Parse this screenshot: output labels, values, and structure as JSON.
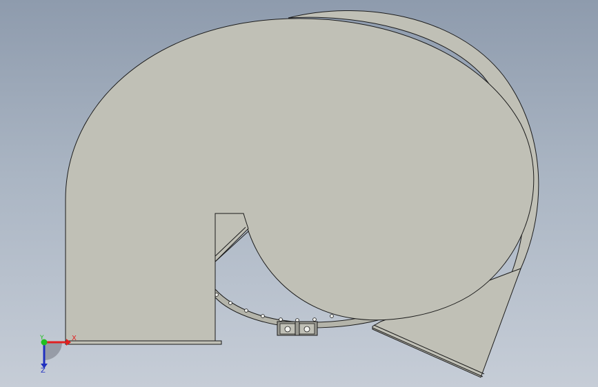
{
  "viewport": {
    "background_top": "#8e9bad",
    "background_bottom": "#c6cdd7"
  },
  "model": {
    "face_color": "#c0c0b6",
    "edge_color": "#1a1a1a",
    "shadow_color": "#9a9a92",
    "hole_color": "#f2f2ee"
  },
  "triad": {
    "x_label": "X",
    "y_label": "Y",
    "z_label": "Z",
    "x_color": "#e02020",
    "y_color": "#20c020",
    "z_color": "#2030c0",
    "icons": [
      "x-axis-arrow",
      "y-axis-dot",
      "z-axis-arrow"
    ]
  }
}
